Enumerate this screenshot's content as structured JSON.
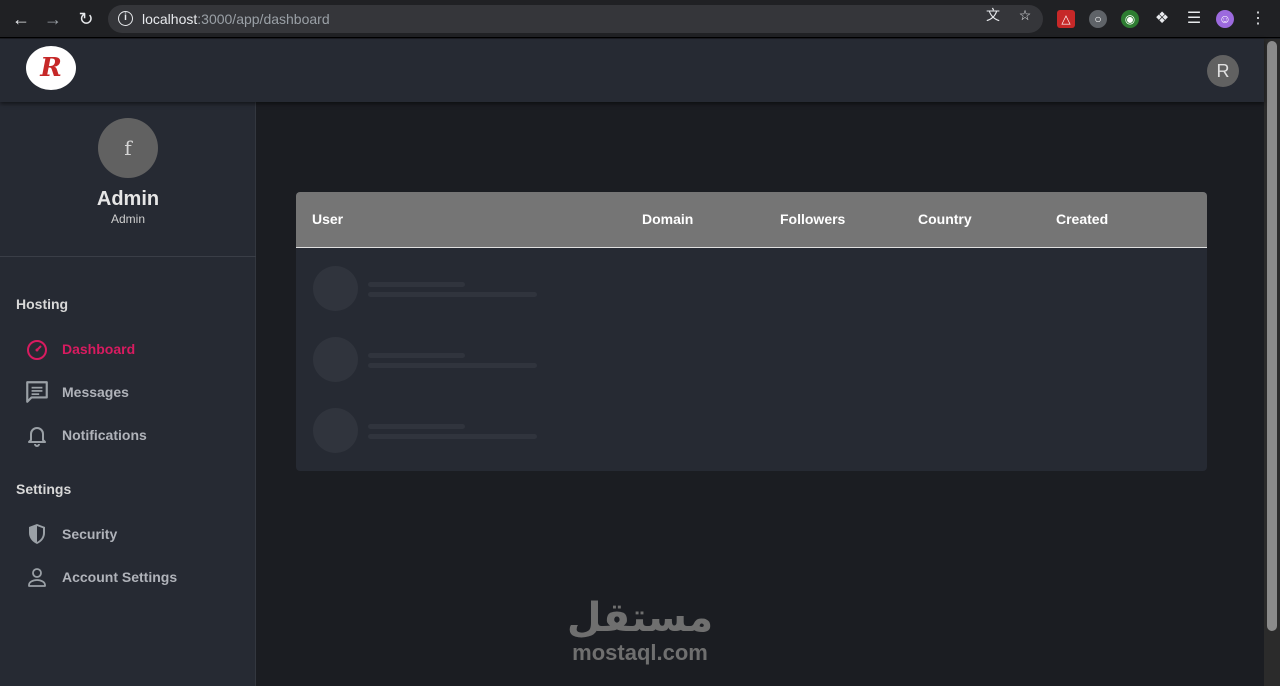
{
  "browser": {
    "url_host": "localhost",
    "url_path": ":3000/app/dashboard"
  },
  "header": {
    "logo_letter": "R",
    "user_initial": "R"
  },
  "profile": {
    "avatar_letter": "f",
    "name": "Admin",
    "role": "Admin"
  },
  "sidebar": {
    "sections": [
      {
        "title": "Hosting",
        "items": [
          {
            "label": "Dashboard",
            "icon": "speedometer-icon",
            "active": true
          },
          {
            "label": "Messages",
            "icon": "message-icon",
            "active": false
          },
          {
            "label": "Notifications",
            "icon": "bell-icon",
            "active": false
          }
        ]
      },
      {
        "title": "Settings",
        "items": [
          {
            "label": "Security",
            "icon": "shield-icon",
            "active": false
          },
          {
            "label": "Account Settings",
            "icon": "person-icon",
            "active": false
          }
        ]
      }
    ]
  },
  "table": {
    "columns": [
      "User",
      "Domain",
      "Followers",
      "Country",
      "Created"
    ],
    "loading_rows": 3
  },
  "watermark": {
    "arabic": "مستقل",
    "latin": "mostaql.com"
  },
  "colors": {
    "accent": "#d81b60",
    "sidebar_bg": "#262a33",
    "page_bg": "#1b1d22",
    "table_header_bg": "#757575"
  }
}
